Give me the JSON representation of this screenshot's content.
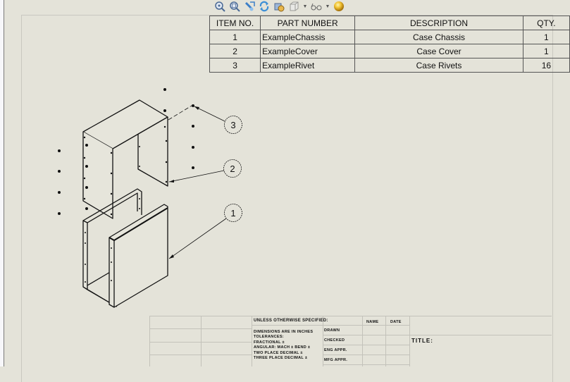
{
  "toolbar": {
    "icons": [
      {
        "name": "zoom-to-fit-icon",
        "glyph": "🔍"
      },
      {
        "name": "zoom-to-area-icon",
        "glyph": "🔍"
      },
      {
        "name": "previous-view-icon",
        "glyph": "↶"
      },
      {
        "name": "rebuild-icon",
        "glyph": "⟳"
      },
      {
        "name": "view-orientation-icon",
        "glyph": "⚙"
      },
      {
        "name": "display-style-icon",
        "glyph": "◧"
      },
      {
        "name": "hide-show-items-icon",
        "glyph": "👓"
      },
      {
        "name": "appearance-icon",
        "glyph": "●"
      }
    ]
  },
  "bom": {
    "headers": {
      "item": "ITEM NO.",
      "part": "PART NUMBER",
      "desc": "DESCRIPTION",
      "qty": "QTY."
    },
    "rows": [
      {
        "item": "1",
        "part": "ExampleChassis",
        "desc": "Case Chassis",
        "qty": "1"
      },
      {
        "item": "2",
        "part": "ExampleCover",
        "desc": "Case Cover",
        "qty": "1"
      },
      {
        "item": "3",
        "part": "ExampleRivet",
        "desc": "Case Rivets",
        "qty": "16"
      }
    ]
  },
  "balloons": [
    {
      "label": "3"
    },
    {
      "label": "2"
    },
    {
      "label": "1"
    }
  ],
  "title_block": {
    "unless_specified": "UNLESS OTHERWISE SPECIFIED:",
    "dims_line1": "DIMENSIONS ARE IN INCHES",
    "dims_line2": "TOLERANCES:",
    "dims_line3": "FRACTIONAL ±",
    "dims_line4": "ANGULAR: MACH ±   BEND ±",
    "dims_line5": "TWO PLACE DECIMAL   ±",
    "dims_line6": "THREE PLACE DECIMAL  ±",
    "name_hdr": "NAME",
    "date_hdr": "DATE",
    "drawn": "DRAWN",
    "checked": "CHECKED",
    "eng_appr": "ENG APPR.",
    "mfg_appr": "MFG APPR.",
    "title_label": "TITLE:"
  }
}
